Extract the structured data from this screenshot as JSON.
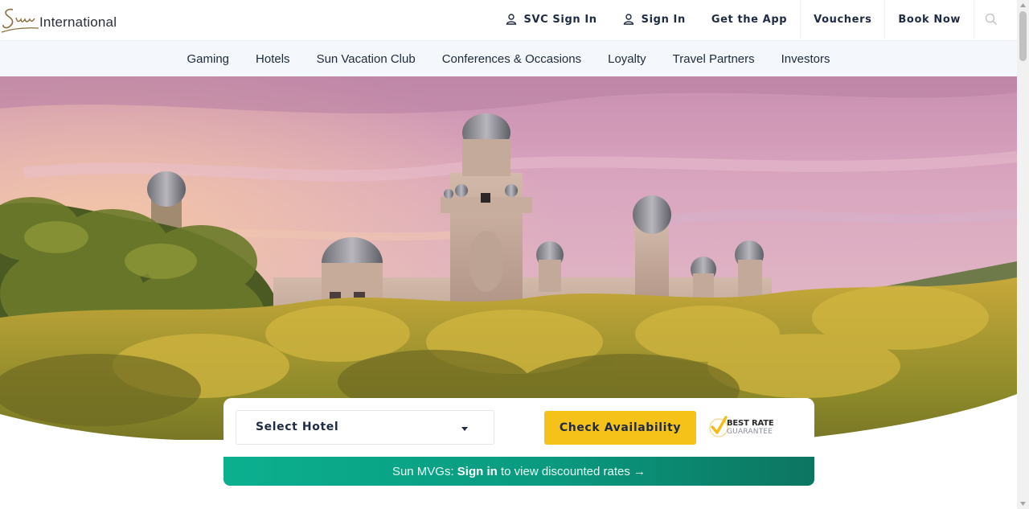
{
  "brand": {
    "name": "International",
    "script_mark": "Sun",
    "logo_icon": "sun-international-logo"
  },
  "top_links": [
    {
      "label": "SVC Sign In",
      "icon": "user-icon"
    },
    {
      "label": "Sign In",
      "icon": "user-icon"
    },
    {
      "label": "Get the App"
    },
    {
      "label": "Vouchers"
    },
    {
      "label": "Book Now"
    }
  ],
  "search": {
    "icon": "search-icon"
  },
  "main_nav": [
    "Gaming",
    "Hotels",
    "Sun Vacation Club",
    "Conferences & Occasions",
    "Loyalty",
    "Travel Partners",
    "Investors"
  ],
  "hero": {
    "image": "palace-of-the-lost-city-photo"
  },
  "booking": {
    "select_label": "Select Hotel",
    "check_button": "Check Availability",
    "best_rate_line1": "BEST RATE",
    "best_rate_line2": "GUARANTEE"
  },
  "mvg": {
    "prefix": "Sun MVGs: ",
    "link": "Sign in",
    "suffix": " to view discounted rates →"
  },
  "colors": {
    "accent_yellow": "#f5c21a",
    "mvg_green": "#0bb08f",
    "nav_bg": "#f4f8fc",
    "text_dark": "#1f2a44"
  }
}
